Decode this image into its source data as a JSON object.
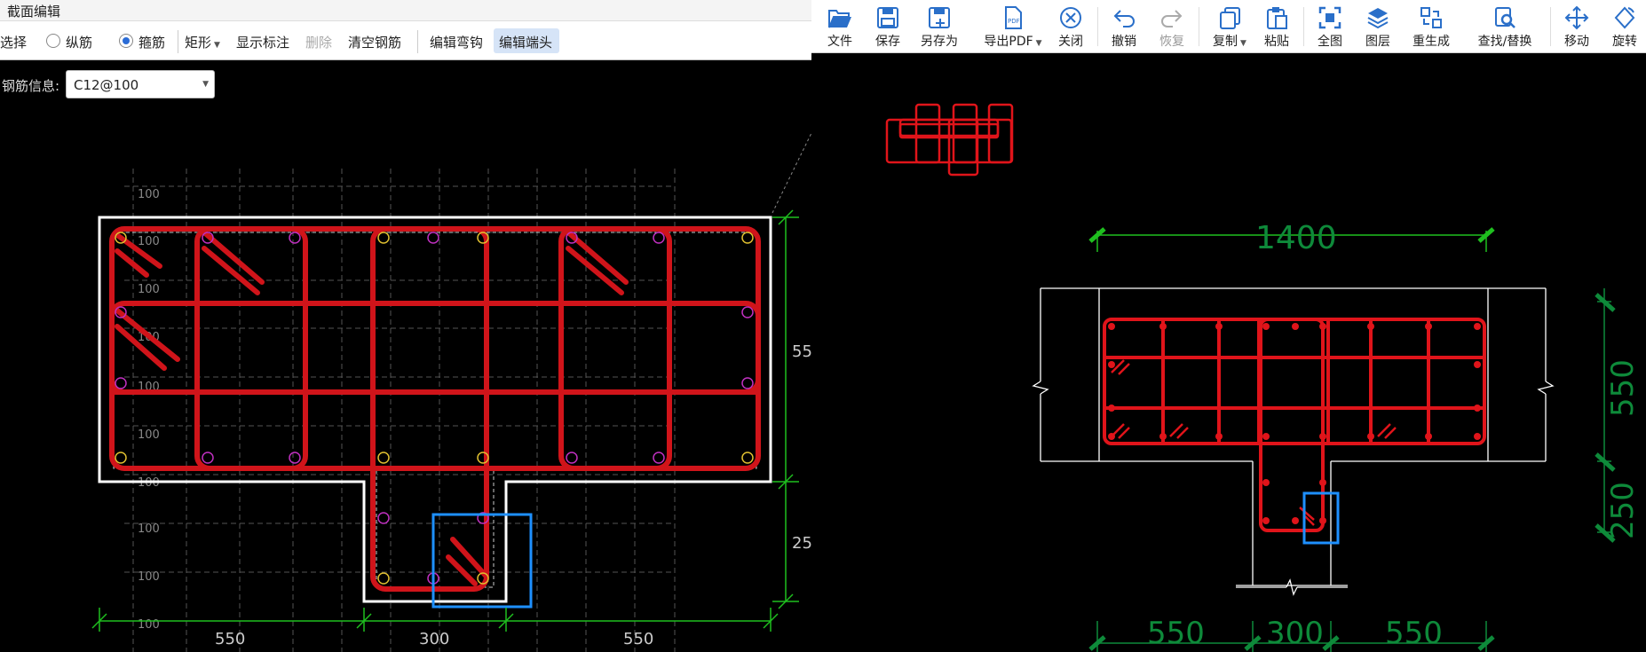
{
  "left": {
    "title": "截面编辑",
    "toolbar": {
      "select": "选择",
      "longitudinal": "纵筋",
      "stirrup": "箍筋",
      "shape": "矩形",
      "show_dims": "显示标注",
      "delete": "删除",
      "clear": "清空钢筋",
      "edit_hook": "编辑弯钩",
      "edit_end": "编辑端头"
    },
    "rebar_info_label": "钢筋信息:",
    "rebar_info_value": "C12@100",
    "grid_labels": [
      "100",
      "100",
      "100",
      "100",
      "100",
      "100",
      "100",
      "100",
      "100",
      "100"
    ],
    "dims_bottom": [
      "550",
      "300",
      "550"
    ],
    "dims_right": [
      "55",
      "25"
    ]
  },
  "right": {
    "toolbar": [
      {
        "label": "文件",
        "icon": "folder-open-icon",
        "disabled": false
      },
      {
        "label": "保存",
        "icon": "save-icon",
        "disabled": false
      },
      {
        "label": "另存为",
        "icon": "save-as-icon",
        "disabled": false
      },
      {
        "label": "导出PDF",
        "icon": "export-pdf-icon",
        "disabled": false,
        "dropdown": true
      },
      {
        "label": "关闭",
        "icon": "close-circle-icon",
        "disabled": false
      },
      {
        "label": "撤销",
        "icon": "undo-icon",
        "disabled": false
      },
      {
        "label": "恢复",
        "icon": "redo-icon",
        "disabled": true
      },
      {
        "label": "复制",
        "icon": "copy-icon",
        "disabled": false,
        "dropdown": true
      },
      {
        "label": "粘贴",
        "icon": "paste-icon",
        "disabled": false
      },
      {
        "label": "全图",
        "icon": "fit-view-icon",
        "disabled": false
      },
      {
        "label": "图层",
        "icon": "layers-icon",
        "disabled": false
      },
      {
        "label": "重生成",
        "icon": "regenerate-icon",
        "disabled": false
      },
      {
        "label": "查找/替换",
        "icon": "find-replace-icon",
        "disabled": false
      },
      {
        "label": "移动",
        "icon": "move-icon",
        "disabled": false
      },
      {
        "label": "旋转",
        "icon": "rotate-icon",
        "disabled": false
      }
    ],
    "dim_top": "1400",
    "dims_right": [
      "550",
      "250"
    ],
    "dims_bottom": [
      "550",
      "300",
      "550"
    ]
  },
  "colors": {
    "rebar": "#e0141a",
    "dim_green": "#1fbf1f",
    "dim_dark_green": "#0e8a3a",
    "highlight": "#1e90ff",
    "icon_blue": "#2a6fc9"
  }
}
